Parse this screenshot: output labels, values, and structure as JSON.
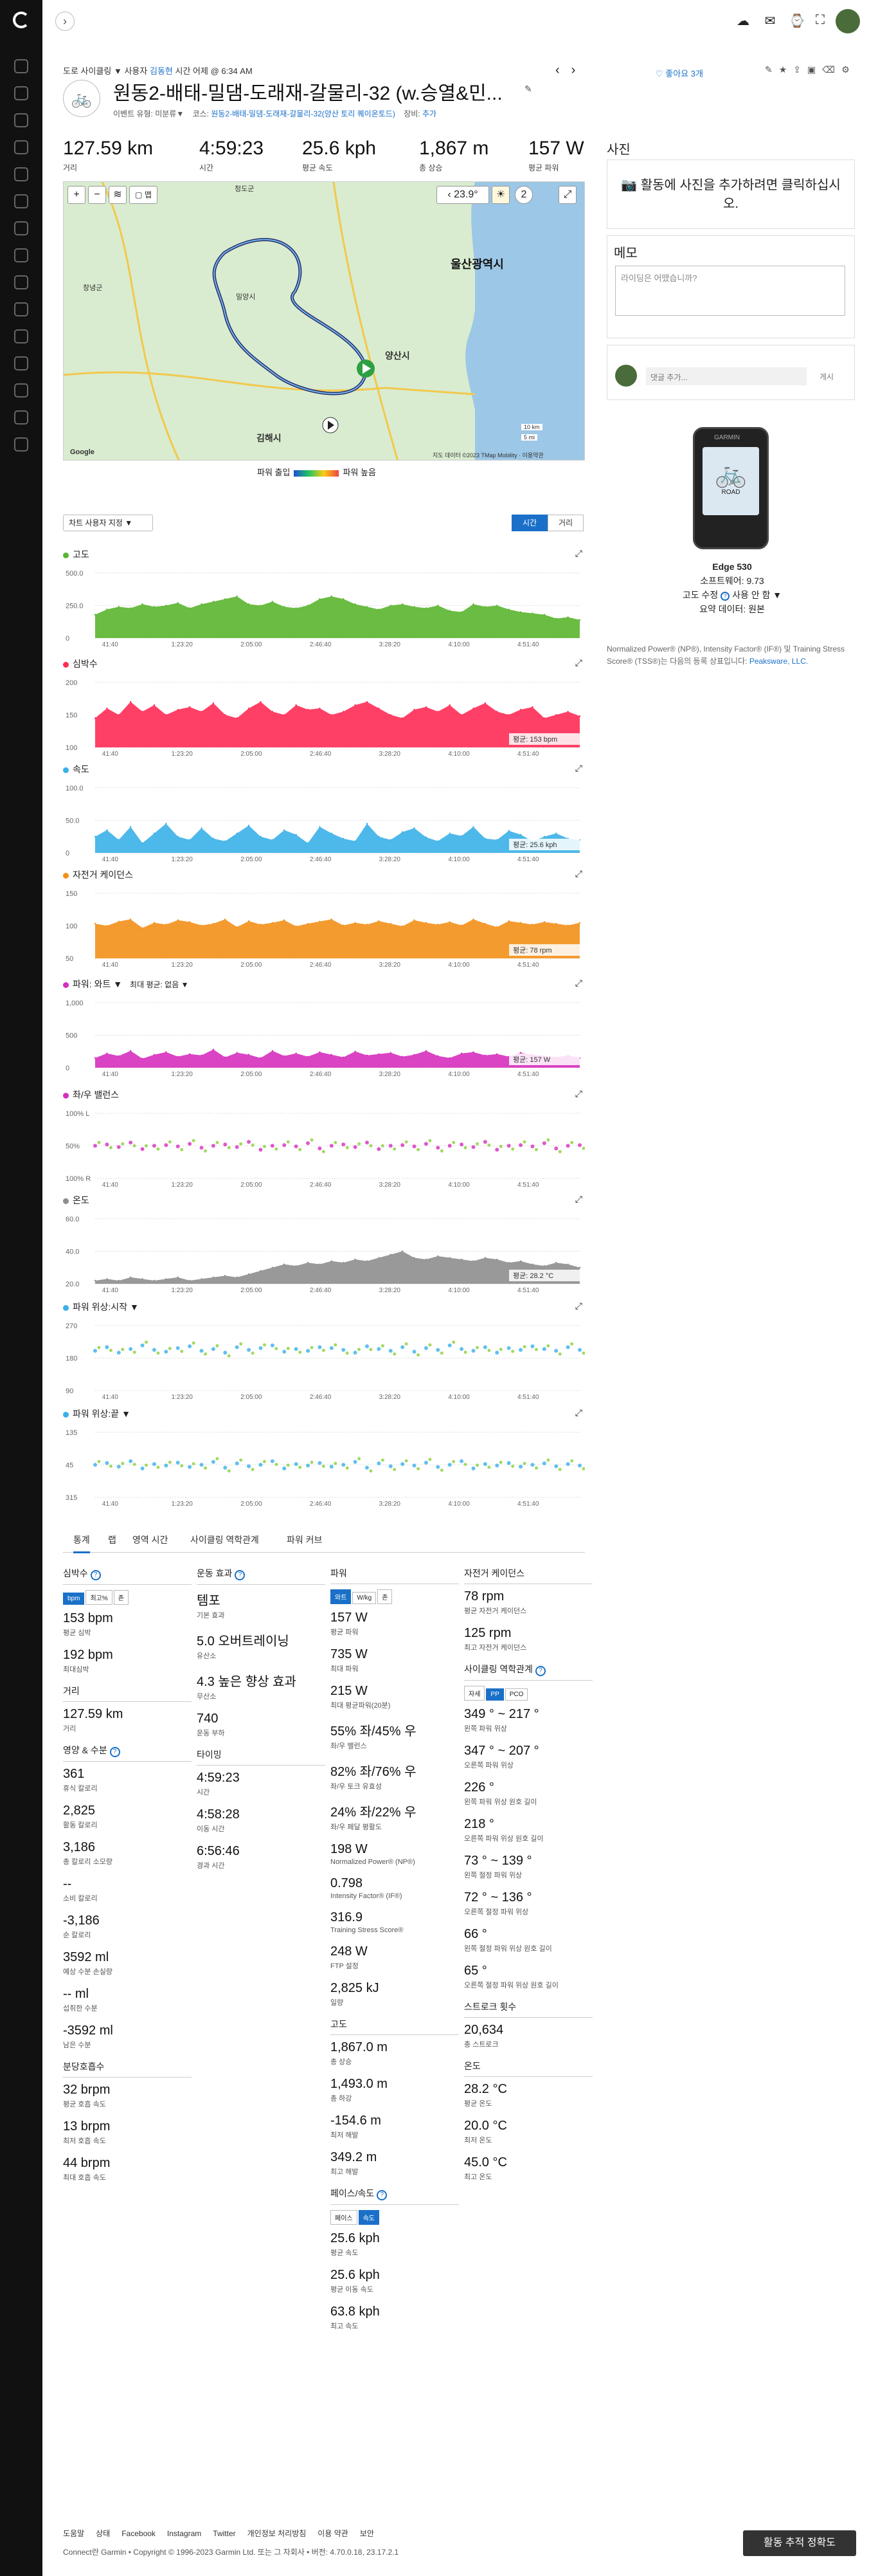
{
  "breadcrumb": {
    "prefix": "도로 사이클링",
    "by": "사용자",
    "user": "김동현",
    "time": "시간 어제 @ 6:34 AM"
  },
  "title": "원동2-배태-밀댐-도래재-갈물리-32 (w.승열&민...",
  "meta": {
    "event_label": "이벤트 유형:",
    "event": "미분류",
    "course_label": "코스:",
    "course": "원동2-배태-밀댐-도래재-갈물리-32(양산 토리 퀘이온토드)",
    "gear_label": "장비:",
    "gear": "추가"
  },
  "likes": "좋아요 3개",
  "summary": [
    {
      "value": "127.59 km",
      "label": "거리"
    },
    {
      "value": "4:59:23",
      "label": "시간"
    },
    {
      "value": "25.6 kph",
      "label": "평균 속도"
    },
    {
      "value": "1,867 m",
      "label": "총 상승"
    },
    {
      "value": "157 W",
      "label": "평균 파워"
    }
  ],
  "map": {
    "temp": "23.9°",
    "wind": "2",
    "big_city": "울산광역시",
    "cities": [
      "양산시",
      "김해시",
      "창녕군",
      "밀양시",
      "청도군"
    ],
    "attribution": "Google",
    "credits": "지도 데이터 ©2023 TMap Mobility · 이용약관",
    "scale1": "10 km",
    "scale2": "5 mi"
  },
  "legend": {
    "left": "파워 출입",
    "right": "파워 높음"
  },
  "chart_controls": {
    "custom": "차트 사용자 지정 ▼",
    "time": "시간",
    "distance": "거리"
  },
  "x_ticks": [
    "41:40",
    "1:23:20",
    "2:05:00",
    "2:46:40",
    "3:28:20",
    "4:10:00",
    "4:51:40"
  ],
  "chart_data": [
    {
      "type": "area",
      "title": "고도",
      "color": "#5ab52e",
      "yticks": [
        "500.0",
        "250.0",
        "0"
      ],
      "ylim": [
        0,
        500
      ],
      "values": [
        180,
        220,
        240,
        230,
        260,
        240,
        250,
        270,
        230,
        260,
        280,
        300,
        320,
        260,
        250,
        280,
        240,
        230,
        250,
        300,
        320,
        300,
        260,
        240,
        220,
        250,
        260,
        240,
        230,
        250,
        210,
        200,
        260,
        240,
        250,
        220,
        200,
        190,
        180,
        150,
        160,
        140
      ]
    },
    {
      "type": "area",
      "title": "심박수",
      "color": "#ff2b55",
      "yticks": [
        "200",
        "150",
        "100"
      ],
      "ylim": [
        100,
        200
      ],
      "avg": "평균: 153 bpm",
      "values": [
        145,
        160,
        150,
        170,
        155,
        165,
        150,
        158,
        162,
        155,
        168,
        150,
        145,
        160,
        170,
        155,
        150,
        165,
        158,
        160,
        150,
        155,
        165,
        170,
        160,
        150,
        145,
        158,
        162,
        155,
        165,
        150,
        160,
        168,
        155,
        150,
        158,
        162,
        145,
        150,
        155,
        148
      ]
    },
    {
      "type": "area",
      "title": "속도",
      "color": "#3ab0e8",
      "yticks": [
        "100.0",
        "50.0",
        "0"
      ],
      "ylim": [
        0,
        100
      ],
      "avg": "평균: 25.6 kph",
      "values": [
        25,
        35,
        20,
        40,
        15,
        30,
        45,
        25,
        20,
        38,
        22,
        18,
        30,
        42,
        25,
        20,
        35,
        28,
        15,
        40,
        30,
        22,
        18,
        45,
        25,
        20,
        32,
        38,
        24,
        18,
        30,
        26,
        40,
        22,
        20,
        34,
        28,
        18,
        25,
        30,
        22,
        20
      ]
    },
    {
      "type": "area",
      "title": "자전거 케이던스",
      "color": "#f39019",
      "yticks": [
        "150",
        "100",
        "50"
      ],
      "ylim": [
        0,
        150
      ],
      "avg": "평균: 78 rpm",
      "values": [
        80,
        75,
        85,
        90,
        70,
        82,
        78,
        88,
        84,
        76,
        80,
        90,
        72,
        86,
        78,
        82,
        88,
        74,
        80,
        85,
        90,
        76,
        82,
        78,
        86,
        80,
        74,
        88,
        82,
        78,
        84,
        76,
        90,
        80,
        72,
        86,
        82,
        78,
        84,
        80,
        76,
        82
      ]
    },
    {
      "type": "area",
      "title": "파워: 와트 ▼",
      "extra": "최대 평균: 없음 ▼",
      "color": "#d62fbd",
      "yticks": [
        "1,000",
        "500",
        "0"
      ],
      "ylim": [
        0,
        1000
      ],
      "avg": "평균: 157 W",
      "values": [
        150,
        220,
        180,
        260,
        140,
        200,
        240,
        170,
        210,
        190,
        280,
        160,
        230,
        200,
        150,
        260,
        180,
        220,
        170,
        240,
        200,
        160,
        250,
        190,
        210,
        230,
        170,
        200,
        260,
        180,
        150,
        220,
        240,
        190,
        210,
        170,
        230,
        200,
        180,
        160,
        190,
        150
      ]
    },
    {
      "type": "scatter",
      "title": "좌/우 밸런스",
      "color": "#d62fbd",
      "yticks": [
        "100% L",
        "50%",
        "100% R"
      ],
      "ylim": [
        0,
        100
      ],
      "values": [
        50,
        52,
        48,
        55,
        45,
        50,
        51,
        49,
        53,
        47,
        50,
        52,
        48,
        56,
        44,
        50,
        51,
        49,
        54,
        46,
        50,
        52,
        48,
        55,
        45,
        50,
        51,
        49,
        53,
        47,
        50,
        52,
        48,
        56,
        44,
        50,
        51,
        49,
        54,
        46,
        50,
        51
      ]
    },
    {
      "type": "area",
      "title": "온도",
      "color": "#8e8e8e",
      "yticks": [
        "60.0",
        "40.0",
        "20.0"
      ],
      "ylim": [
        20,
        60
      ],
      "avg": "평균: 28.2 °C",
      "values": [
        22,
        23,
        22,
        24,
        23,
        22,
        23,
        24,
        22,
        23,
        24,
        25,
        24,
        26,
        28,
        30,
        32,
        31,
        33,
        32,
        34,
        33,
        35,
        34,
        36,
        38,
        40,
        36,
        35,
        37,
        36,
        35,
        34,
        36,
        35,
        33,
        34,
        32,
        31,
        33,
        32,
        30
      ]
    },
    {
      "type": "scatter",
      "title": "파워 위상:시작 ▼",
      "color": "#3ab0e8",
      "yticks": [
        "270",
        "180",
        "90"
      ],
      "ylim": [
        0,
        360
      ],
      "values": [
        220,
        240,
        210,
        230,
        250,
        225,
        215,
        235,
        245,
        220,
        230,
        210,
        240,
        225,
        235,
        250,
        215,
        230,
        220,
        240,
        235,
        225,
        210,
        245,
        230,
        220,
        240,
        215,
        235,
        225,
        250,
        230,
        220,
        240,
        210,
        235,
        225,
        245,
        230,
        220,
        240,
        225
      ]
    },
    {
      "type": "scatter",
      "title": "파워 위상:끝 ▼",
      "color": "#3ab0e8",
      "yticks": [
        "135",
        "45",
        "315"
      ],
      "ylim": [
        0,
        180
      ],
      "values": [
        90,
        95,
        85,
        100,
        80,
        92,
        88,
        96,
        84,
        90,
        98,
        82,
        94,
        86,
        90,
        100,
        80,
        92,
        88,
        95,
        85,
        90,
        98,
        82,
        94,
        86,
        92,
        88,
        96,
        84,
        90,
        100,
        80,
        92,
        88,
        95,
        85,
        90,
        94,
        86,
        92,
        88
      ]
    }
  ],
  "tabs": [
    "통계",
    "랩",
    "영역 시간",
    "사이클링 역학관계",
    "파워 커브"
  ],
  "col1": {
    "hr_title": "심박수",
    "hr_seg": [
      "bpm",
      "최고%",
      "존"
    ],
    "hr": [
      {
        "v": "153 bpm",
        "l": "평균 심박"
      },
      {
        "v": "192 bpm",
        "l": "최대심박"
      }
    ],
    "dist_title": "거리",
    "dist": [
      {
        "v": "127.59 km",
        "l": "거리"
      }
    ],
    "energy_title": "영양 & 수분",
    "energy": [
      {
        "v": "361",
        "l": "휴식 칼로리"
      },
      {
        "v": "2,825",
        "l": "활동 칼로리"
      },
      {
        "v": "3,186",
        "l": "총 칼로리 소모량"
      },
      {
        "v": "--",
        "l": "소비 칼로리"
      },
      {
        "v": "-3,186",
        "l": "순 칼로리"
      },
      {
        "v": "3592 ml",
        "l": "예상 수분 손실량"
      },
      {
        "v": "-- ml",
        "l": "섭취한 수분"
      },
      {
        "v": "-3592 ml",
        "l": "남은 수분"
      }
    ],
    "resp_title": "분당호흡수",
    "resp": [
      {
        "v": "32 brpm",
        "l": "평균 호흡 속도"
      },
      {
        "v": "13 brpm",
        "l": "최저 호흡 속도"
      },
      {
        "v": "44 brpm",
        "l": "최대 호흡 속도"
      }
    ]
  },
  "col2": {
    "eff_title": "운동 효과",
    "eff": [
      {
        "v": "템포",
        "l": "기본 효과"
      },
      {
        "v": "5.0 오버트레이닝",
        "l": "유산소"
      },
      {
        "v": "4.3 높은 향상 효과",
        "l": "무산소"
      },
      {
        "v": "740",
        "l": "운동 부하"
      }
    ],
    "timing_title": "타이밍",
    "timing": [
      {
        "v": "4:59:23",
        "l": "시간"
      },
      {
        "v": "4:58:28",
        "l": "이동 시간"
      },
      {
        "v": "6:56:46",
        "l": "경과 시간"
      }
    ]
  },
  "col3": {
    "power_title": "파워",
    "power_seg": [
      "와트",
      "W/kg",
      "존"
    ],
    "power": [
      {
        "v": "157 W",
        "l": "평균 파워"
      },
      {
        "v": "735 W",
        "l": "최대 파워"
      },
      {
        "v": "215 W",
        "l": "최대 평균파워(20분)"
      },
      {
        "v": "55% 좌/45% 우",
        "l": "좌/우 밸런스"
      },
      {
        "v": "82% 좌/76% 우",
        "l": "좌/우 토크 유효성"
      },
      {
        "v": "24% 좌/22% 우",
        "l": "좌/우 페달 평활도"
      },
      {
        "v": "198 W",
        "l": "Normalized Power® (NP®)"
      },
      {
        "v": "0.798",
        "l": "Intensity Factor® (IF®)"
      },
      {
        "v": "316.9",
        "l": "Training Stress Score®"
      },
      {
        "v": "248 W",
        "l": "FTP 설정"
      },
      {
        "v": "2,825 kJ",
        "l": "일량"
      }
    ],
    "elev_title": "고도",
    "elev": [
      {
        "v": "1,867.0 m",
        "l": "총 상승"
      },
      {
        "v": "1,493.0 m",
        "l": "총 하강"
      },
      {
        "v": "-154.6 m",
        "l": "최저 해발"
      },
      {
        "v": "349.2 m",
        "l": "최고 해발"
      }
    ],
    "pace_title": "페이스/속도",
    "pace_seg": [
      "페이스",
      "속도"
    ],
    "pace": [
      {
        "v": "25.6 kph",
        "l": "평균 속도"
      },
      {
        "v": "25.6 kph",
        "l": "평균 이동 속도"
      },
      {
        "v": "63.8 kph",
        "l": "최고 속도"
      }
    ]
  },
  "col4": {
    "cad_title": "자전거 케이던스",
    "cad": [
      {
        "v": "78 rpm",
        "l": "평균 자전거 케이던스"
      },
      {
        "v": "125 rpm",
        "l": "최고 자전거 케이던스"
      }
    ],
    "dyn_title": "사이클링 역학관계",
    "dyn_seg": [
      "자세",
      "PP",
      "PCO"
    ],
    "dyn": [
      {
        "v": "349 ° ~ 217 °",
        "l": "왼쪽 파워 위상"
      },
      {
        "v": "347 ° ~ 207 °",
        "l": "오른쪽 파워 위상"
      },
      {
        "v": "226 °",
        "l": "왼쪽 파워 위상 원호 길이"
      },
      {
        "v": "218 °",
        "l": "오른쪽 파워 위상 원호 길이"
      },
      {
        "v": "73 ° ~ 139 °",
        "l": "왼쪽 절정 파워 위상"
      },
      {
        "v": "72 ° ~ 136 °",
        "l": "오른쪽 절정 파워 위상"
      },
      {
        "v": "66 °",
        "l": "왼쪽 절정 파워 위상 원호 길이"
      },
      {
        "v": "65 °",
        "l": "오른쪽 절정 파워 위상 원호 길이"
      }
    ],
    "stroke_title": "스트로크 횟수",
    "stroke": [
      {
        "v": "20,634",
        "l": "총 스트로크"
      }
    ],
    "temp_title": "온도",
    "temp": [
      {
        "v": "28.2 °C",
        "l": "평균 온도"
      },
      {
        "v": "20.0 °C",
        "l": "최저 온도"
      },
      {
        "v": "45.0 °C",
        "l": "최고 온도"
      }
    ]
  },
  "right": {
    "photos_title": "사진",
    "photos_prompt": "활동에 사진을 추가하려면 클릭하십시오.",
    "memo_title": "메모",
    "memo_placeholder": "라이딩은 어땠습니까?",
    "comment_placeholder": "댓글 추가...",
    "comment_post": "게시",
    "device_brand": "GARMIN",
    "device_screen": "ROAD",
    "device_name": "Edge 530",
    "software": "소프트웨어: 9.73",
    "elev_corr": "고도 수정",
    "elev_corr_val": "사용 안 함 ▼",
    "summary_data": "요약 데이터: 원본",
    "disclaimer": "Normalized Power® (NP®), Intensity Factor® (IF®) 및 Training Stress Score® (TSS®)는 다음의 등록 상표입니다:",
    "disclaimer_link": "Peaksware, LLC."
  },
  "footer": {
    "links": [
      "도움말",
      "상태",
      "Facebook",
      "Instagram",
      "Twitter",
      "개인정보 처리방침",
      "이용 약관",
      "보안"
    ],
    "copyright": "Connect란 Garmin • Copyright © 1996-2023 Garmin Ltd. 또는 그 자회사 • 버전: 4.70.0.18, 23.17.2.1",
    "feedback": "활동 추적 정확도"
  }
}
